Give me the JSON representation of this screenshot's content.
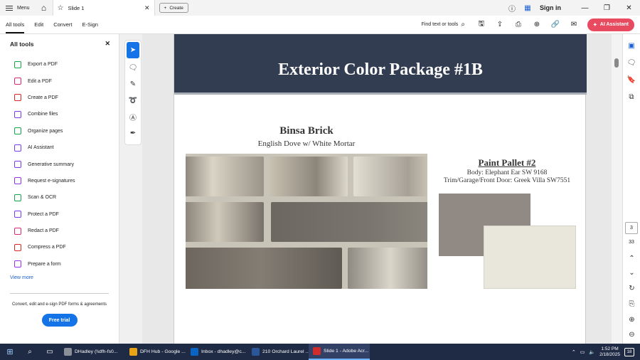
{
  "titlebar": {
    "menu_label": "Menu",
    "tab_title": "Slide 1",
    "create_label": "Create",
    "signin_label": "Sign in"
  },
  "toolbar": {
    "menu_items": [
      "All tools",
      "Edit",
      "Convert",
      "E-Sign"
    ],
    "find_label": "Find text or tools",
    "ai_assistant_label": "AI Assistant"
  },
  "sidebar": {
    "title": "All tools",
    "items": [
      {
        "label": "Export a PDF",
        "color": "#16a34a",
        "icon": "export-pdf-icon"
      },
      {
        "label": "Edit a PDF",
        "color": "#db2777",
        "icon": "edit-pdf-icon"
      },
      {
        "label": "Create a PDF",
        "color": "#dc2626",
        "icon": "create-pdf-icon"
      },
      {
        "label": "Combine files",
        "color": "#7c3aed",
        "icon": "combine-files-icon"
      },
      {
        "label": "Organize pages",
        "color": "#16a34a",
        "icon": "organize-pages-icon"
      },
      {
        "label": "AI Assistant",
        "color": "#7c3aed",
        "icon": "ai-assistant-icon"
      },
      {
        "label": "Generative summary",
        "color": "#7c3aed",
        "icon": "generative-summary-icon"
      },
      {
        "label": "Request e-signatures",
        "color": "#9333ea",
        "icon": "request-esignatures-icon"
      },
      {
        "label": "Scan & OCR",
        "color": "#16a34a",
        "icon": "scan-ocr-icon"
      },
      {
        "label": "Protect a PDF",
        "color": "#7c3aed",
        "icon": "protect-pdf-icon"
      },
      {
        "label": "Redact a PDF",
        "color": "#db2777",
        "icon": "redact-pdf-icon"
      },
      {
        "label": "Compress a PDF",
        "color": "#dc2626",
        "icon": "compress-pdf-icon"
      },
      {
        "label": "Prepare a form",
        "color": "#9333ea",
        "icon": "prepare-form-icon"
      }
    ],
    "view_more": "View more",
    "promo_text": "Convert, edit and e-sign PDF forms & agreements",
    "free_trial_label": "Free trial"
  },
  "document": {
    "banner_title": "Exterior Color Package #1B",
    "brick_title": "Binsa Brick",
    "brick_subtitle": "English Dove w/ White Mortar",
    "palette_title": "Paint Pallet #2",
    "palette_body": "Body: Elephant Ear SW 9168",
    "palette_trim": "Trim/Garage/Front Door: Greek Villa SW7551",
    "swatch_colors": [
      "#918a84",
      "#e9e7dc"
    ]
  },
  "page_nav": {
    "current_page": "3",
    "total_pages": "33"
  },
  "taskbar": {
    "apps": [
      {
        "label": "DHadley (\\\\dfh-fs0...",
        "color": "#8a8f99"
      },
      {
        "label": "DFH Hub - Google ...",
        "color": "#e8a317"
      },
      {
        "label": "Inbox - dhadley@c...",
        "color": "#0a64c4"
      },
      {
        "label": "210 Orchard Laurel ...",
        "color": "#2b579a"
      },
      {
        "label": "Slide 1 - Adobe Acr...",
        "color": "#d12c2c"
      }
    ],
    "time": "1:52 PM",
    "date": "2/18/2025",
    "notification_count": "18"
  }
}
